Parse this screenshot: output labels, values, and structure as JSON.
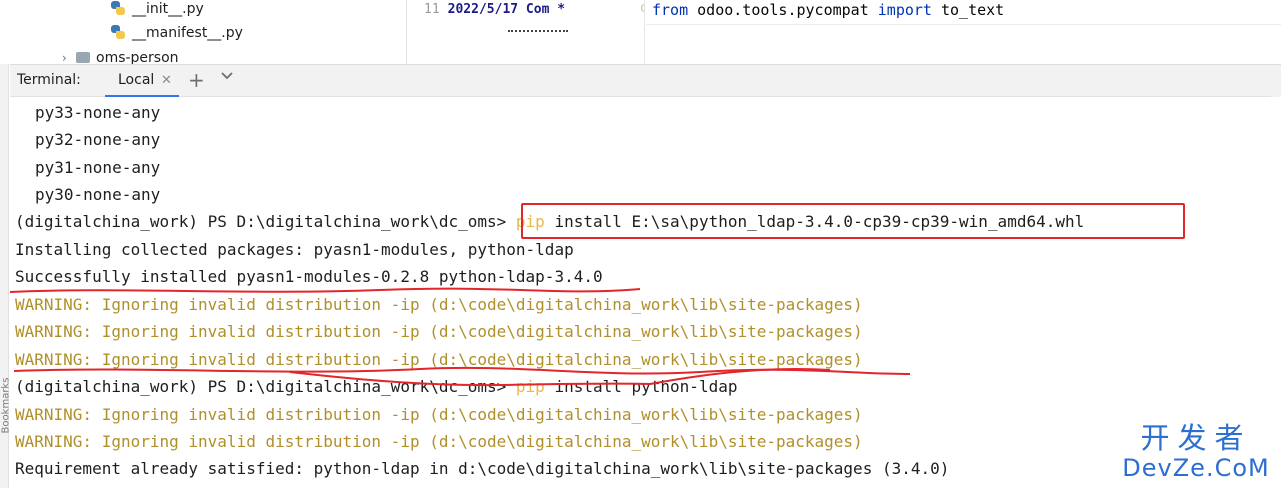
{
  "project_tree": {
    "items": [
      {
        "label": "__init__.py",
        "icon": "python-file-icon"
      },
      {
        "label": "__manifest__.py",
        "icon": "python-file-icon"
      },
      {
        "label": "oms-person",
        "icon": "folder-icon"
      }
    ]
  },
  "editor": {
    "gutter_line_number": "11",
    "blame_text": "2022/5/17 Com",
    "blame_marker": "*",
    "code_keyword_from": "from",
    "code_module": " odoo.tools.pycompat ",
    "code_keyword_import": "import",
    "code_name": " to_text"
  },
  "terminal": {
    "title": "Terminal:",
    "tab_label": "Local",
    "tab_close": "✕",
    "add_label": "+",
    "more_label": "⌄",
    "lines": {
      "l1": "py33-none-any",
      "l2": "py32-none-any",
      "l3": "py31-none-any",
      "l4": "py30-none-any",
      "l5_prompt": "(digitalchina_work) PS D:\\digitalchina_work\\dc_oms> ",
      "l5_pip": "pip",
      "l5_rest": " install E:\\sa\\python_ldap-3.4.0-cp39-cp39-win_amd64.whl",
      "l6": "Installing collected packages: pyasn1-modules, python-ldap",
      "l7": "Successfully installed pyasn1-modules-0.2.8 python-ldap-3.4.0",
      "l8": "WARNING: Ignoring invalid distribution -ip (d:\\code\\digitalchina_work\\lib\\site-packages)",
      "l9": "WARNING: Ignoring invalid distribution -ip (d:\\code\\digitalchina_work\\lib\\site-packages)",
      "l10": "WARNING: Ignoring invalid distribution -ip (d:\\code\\digitalchina_work\\lib\\site-packages)",
      "l11_prompt": "(digitalchina_work) PS D:\\digitalchina_work\\dc_oms> ",
      "l11_pip": "pip",
      "l11_rest": " install python-ldap",
      "l12": "WARNING: Ignoring invalid distribution -ip (d:\\code\\digitalchina_work\\lib\\site-packages)",
      "l13": "WARNING: Ignoring invalid distribution -ip (d:\\code\\digitalchina_work\\lib\\site-packages)",
      "l14": "Requirement already satisfied: python-ldap in d:\\code\\digitalchina_work\\lib\\site-packages (3.4.0)"
    }
  },
  "side_panel": {
    "label": "Bookmarks"
  },
  "watermark": {
    "line1": "开发者",
    "line2": "DevZe.CoM"
  },
  "colors": {
    "annotation_red": "#e2262c",
    "warning_text": "#b0902a",
    "pip_text": "#e8b84a",
    "tab_accent": "#3574f0"
  }
}
